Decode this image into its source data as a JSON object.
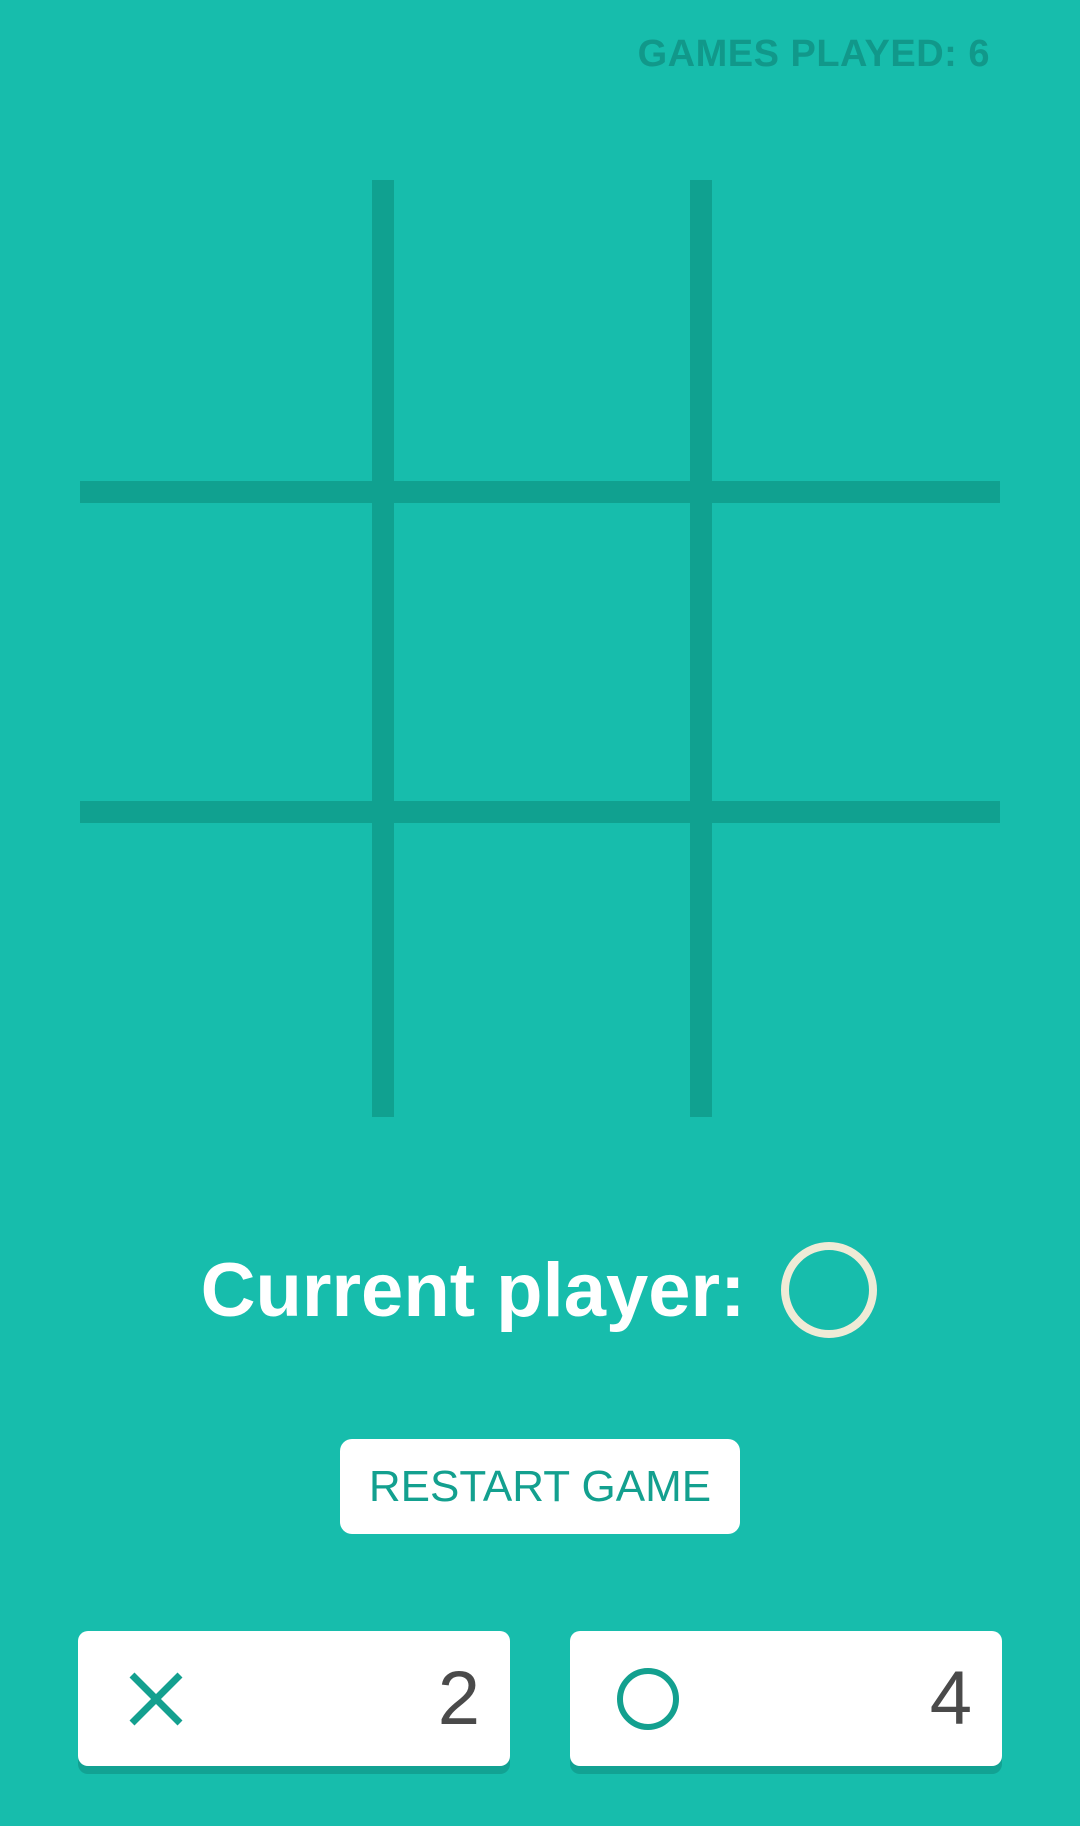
{
  "header": {
    "games_played": "GAMES PLAYED: 6"
  },
  "board": {
    "cells": [
      "",
      "",
      "",
      "",
      "",
      "",
      "",
      "",
      ""
    ]
  },
  "status": {
    "current_player_label": "Current player:",
    "current_player_mark": "O"
  },
  "restart_button": {
    "label": "RESTART GAME"
  },
  "scores": {
    "x": {
      "mark": "X",
      "value": "2"
    },
    "o": {
      "mark": "O",
      "value": "4"
    }
  },
  "colors": {
    "background": "#17bdac",
    "grid": "#10a190",
    "accent": "#13a08f",
    "current_player_circle": "#efebd6",
    "score_text": "#4a4a4a"
  }
}
